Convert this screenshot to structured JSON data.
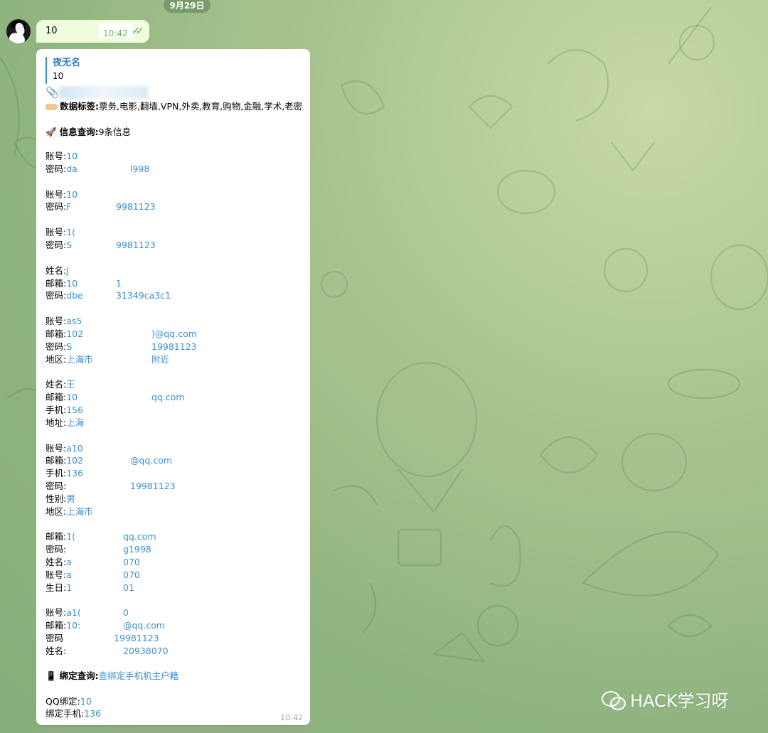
{
  "date_pill": "9月29日",
  "outgoing": {
    "text": "10",
    "time": "10:42",
    "check_icon": "double-check-icon"
  },
  "incoming": {
    "reply_name": "夜无名",
    "reply_text": "10",
    "clip_icon": "paperclip-icon",
    "tags_label": "数据标签:",
    "tags_value": "票务,电影,翻墙,VPN,外卖,教育,购物,金融,学术,老密",
    "info_label": "信息查询:",
    "info_value": "9条信息",
    "records": [
      [
        {
          "k": "账号:",
          "v": "10"
        },
        {
          "k": "密码:",
          "v": "da",
          "v2": "l998"
        }
      ],
      [
        {
          "k": "账号:",
          "v": "10"
        },
        {
          "k": "密码:",
          "v": "F",
          "v2": "9981123"
        }
      ],
      [
        {
          "k": "账号:",
          "v": "1("
        },
        {
          "k": "密码:",
          "v": "S",
          "v2": "9981123"
        }
      ],
      [
        {
          "k": "姓名:",
          "v": "J"
        },
        {
          "k": "邮箱:",
          "v": "10",
          "v2": "1"
        },
        {
          "k": "密码:",
          "v": "dbe",
          "v2": "31349ca3c1"
        }
      ],
      [
        {
          "k": "账号:",
          "v": "as5"
        },
        {
          "k": "邮箱:",
          "v": "102",
          "v2": ")@qq.com"
        },
        {
          "k": "密码:",
          "v": "S",
          "v2": "19981123"
        },
        {
          "k": "地区:",
          "v": "上海市",
          "v2": "附近"
        }
      ],
      [
        {
          "k": "姓名:",
          "v": "王"
        },
        {
          "k": "邮箱:",
          "v": "10",
          "v2": "qq.com"
        },
        {
          "k": "手机:",
          "v": "156"
        },
        {
          "k": "地址:",
          "v": "上海"
        }
      ],
      [
        {
          "k": "账号:",
          "v": "a10"
        },
        {
          "k": "邮箱:",
          "v": "102",
          "v2": "@qq.com"
        },
        {
          "k": "手机:",
          "v": "136"
        },
        {
          "k": "密码:",
          "v": "",
          "v2": "19981123"
        },
        {
          "k": "性别:",
          "v": "男"
        },
        {
          "k": "地区:",
          "v": "上海市"
        }
      ],
      [
        {
          "k": "邮箱:",
          "v": "1(",
          "v2": "qq.com"
        },
        {
          "k": "密码:",
          "v": "",
          "v2": "g1998"
        },
        {
          "k": "姓名:",
          "v": "a",
          "v2": "070"
        },
        {
          "k": "账号:",
          "v": "a",
          "v2": "070"
        },
        {
          "k": "生日:",
          "v": "1",
          "v2": "01"
        }
      ],
      [
        {
          "k": "账号:",
          "v": "a1(",
          "v2": "0"
        },
        {
          "k": "邮箱:",
          "v": "10:",
          "v2": "@qq.com"
        },
        {
          "k": "密码",
          "v": "",
          "v2": "19981123"
        },
        {
          "k": "姓名:",
          "v": "",
          "v2": "20938070"
        }
      ]
    ],
    "bind_label": "绑定查询:",
    "bind_link": "查绑定手机机主户籍",
    "qq_label": "QQ绑定:",
    "qq_value": "10",
    "phone_label": "绑定手机:",
    "phone_value": "136",
    "time": "10:42"
  },
  "watermark": "HACK学习呀",
  "colors": {
    "link": "#3a8fd0",
    "name": "#2d7fc1",
    "out_bubble": "#effdde"
  }
}
